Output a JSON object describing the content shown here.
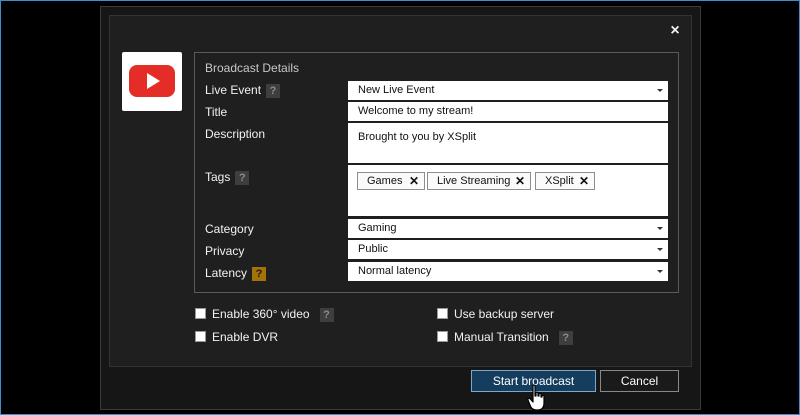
{
  "dialog": {
    "close_glyph": "×",
    "service_logo": "youtube-logo",
    "group_title": "Broadcast Details"
  },
  "form": {
    "live_event": {
      "label": "Live Event",
      "value": "New Live Event",
      "help": "?"
    },
    "title": {
      "label": "Title",
      "value": "Welcome to my stream!"
    },
    "description": {
      "label": "Description",
      "value": "Brought to you by XSplit"
    },
    "tags": {
      "label": "Tags",
      "help": "?",
      "items": [
        "Games",
        "Live Streaming",
        "XSplit"
      ],
      "remove_glyph": "✕"
    },
    "category": {
      "label": "Category",
      "value": "Gaming"
    },
    "privacy": {
      "label": "Privacy",
      "value": "Public"
    },
    "latency": {
      "label": "Latency",
      "value": "Normal latency",
      "help": "?"
    }
  },
  "options": {
    "enable_360": {
      "label": "Enable 360° video",
      "checked": false,
      "help": "?"
    },
    "enable_dvr": {
      "label": "Enable DVR",
      "checked": false
    },
    "backup_server": {
      "label": "Use backup server",
      "checked": false
    },
    "manual_transition": {
      "label": "Manual Transition",
      "checked": false,
      "help": "?"
    }
  },
  "buttons": {
    "start": "Start broadcast",
    "cancel": "Cancel"
  },
  "colors": {
    "accent_border": "#3a8fd0",
    "primary_button": "#153d5e",
    "latency_help": "#a57208",
    "youtube_red": "#e52d27"
  }
}
